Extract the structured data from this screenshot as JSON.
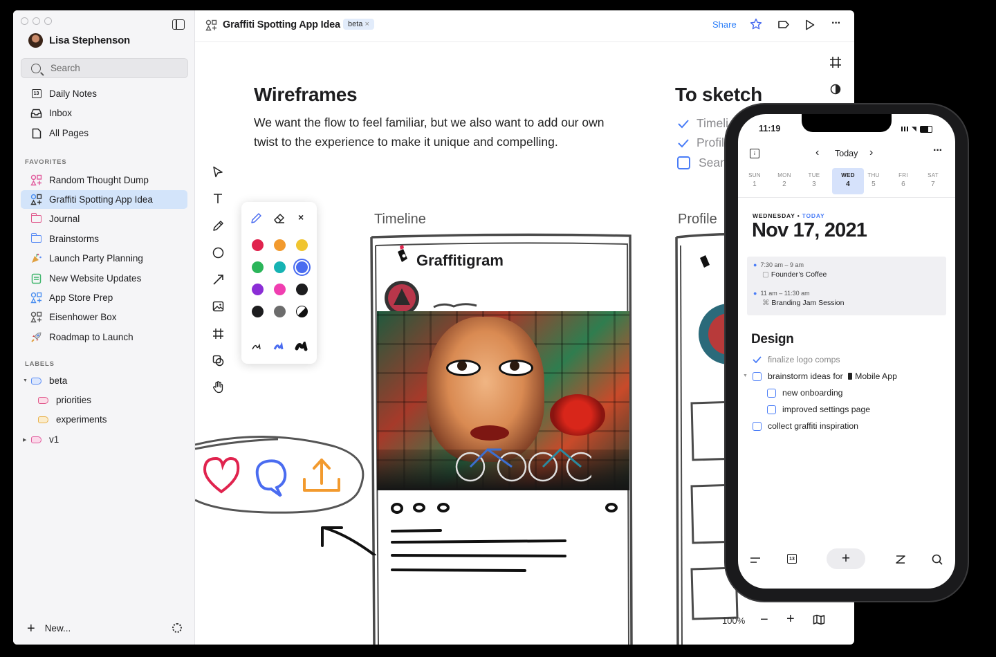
{
  "sidebar": {
    "user_name": "Lisa Stephenson",
    "search_placeholder": "Search",
    "nav": [
      {
        "label": "Daily Notes",
        "icon": "calendar-icon"
      },
      {
        "label": "Inbox",
        "icon": "inbox-icon"
      },
      {
        "label": "All Pages",
        "icon": "page-icon"
      }
    ],
    "favorites_heading": "FAVORITES",
    "favorites": [
      {
        "label": "Random Thought Dump",
        "icon": "shapes-icon",
        "color": "#e05a9c"
      },
      {
        "label": "Graffiti Spotting App Idea",
        "icon": "shapes-icon",
        "color": "#333333",
        "active": true
      },
      {
        "label": "Journal",
        "icon": "folder-icon",
        "color": "#e0568a"
      },
      {
        "label": "Brainstorms",
        "icon": "folder-icon",
        "color": "#5b8df5"
      },
      {
        "label": "Launch Party Planning",
        "icon": "party-popper-icon",
        "color": "#e0a040"
      },
      {
        "label": "New Website Updates",
        "icon": "document-icon",
        "color": "#3fb56b"
      },
      {
        "label": "App Store Prep",
        "icon": "shapes-icon",
        "color": "#4a8ef0"
      },
      {
        "label": "Eisenhower Box",
        "icon": "shapes-icon",
        "color": "#555555"
      },
      {
        "label": "Roadmap to Launch",
        "icon": "rocket-icon",
        "color": "#d04040"
      }
    ],
    "labels_heading": "LABELS",
    "labels": [
      {
        "label": "beta",
        "color": "#5b8df5"
      },
      {
        "label": "priorities",
        "color": "#e0568a"
      },
      {
        "label": "experiments",
        "color": "#e8b04a"
      },
      {
        "label": "v1",
        "color": "#e05a9c"
      }
    ],
    "new_label": "New..."
  },
  "toolbar": {
    "doc_title": "Graffiti Spotting App Idea",
    "label_chip": "beta",
    "share_label": "Share"
  },
  "canvas": {
    "wireframes_title": "Wireframes",
    "wireframes_body_line1": "We want the flow to feel familiar, but we also want to add our own",
    "wireframes_body_line2": "twist to the experience to make it unique and compelling.",
    "to_sketch_title": "To sketch",
    "to_sketch_items": [
      "Timeli",
      "Profil",
      "Searc"
    ],
    "timeline_label": "Timeline",
    "profile_label": "Profile",
    "app_name": "Graffitigram",
    "zoom": "100%"
  },
  "palette": {
    "colors": [
      "#e0234e",
      "#f29a2e",
      "#f0c530",
      "#2bb55a",
      "#16b3b3",
      "#4a6cf0",
      "#8b2ed6",
      "#f03eb0",
      "#1d1d1f",
      "#1d1d1f",
      "#6c6c6c",
      "half"
    ],
    "selected_color": "#4a6cf0"
  },
  "phone": {
    "time": "11:19",
    "today_label": "Today",
    "week": [
      {
        "day": "SUN",
        "date": "1"
      },
      {
        "day": "MON",
        "date": "2"
      },
      {
        "day": "TUE",
        "date": "3"
      },
      {
        "day": "WED",
        "date": "4",
        "selected": true
      },
      {
        "day": "THU",
        "date": "5"
      },
      {
        "day": "FRI",
        "date": "6"
      },
      {
        "day": "SAT",
        "date": "7"
      }
    ],
    "weekday_label": "WEDNESDAY",
    "today_tag": "TODAY",
    "date_title": "Nov 17, 2021",
    "events": [
      {
        "time": "7:30 am – 9 am",
        "title": "Founder’s Coffee"
      },
      {
        "time": "11 am – 11:30 am",
        "title": "Branding Jam Session"
      }
    ],
    "section_title": "Design",
    "todos": [
      {
        "text": "finalize logo comps",
        "done": true
      },
      {
        "text": "brainstorm ideas for",
        "link": "Mobile App",
        "done": false
      },
      {
        "text": "new onboarding",
        "done": false,
        "indent": true
      },
      {
        "text": "improved settings page",
        "done": false,
        "indent": true
      },
      {
        "text": "collect graffiti inspiration",
        "done": false
      }
    ]
  }
}
